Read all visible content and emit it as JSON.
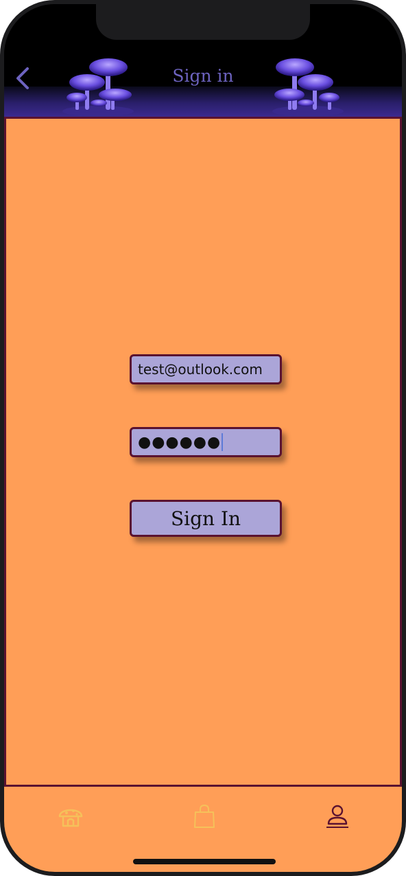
{
  "nav": {
    "title": "Sign in",
    "back_icon": "chevron-left-icon",
    "title_color": "#6d63c0"
  },
  "form": {
    "email_value": "test@outlook.com",
    "password_value": "●●●●●●",
    "sign_in_label": "Sign In"
  },
  "tabbar": {
    "items": [
      {
        "icon": "mushroom-house-icon",
        "color": "#f5c15a",
        "selected": false
      },
      {
        "icon": "shopping-bag-icon",
        "color": "#f5c15a",
        "selected": false
      },
      {
        "icon": "person-icon",
        "color": "#5a1230",
        "selected": true
      }
    ]
  },
  "colors": {
    "background": "#ff9e57",
    "field_fill": "#aba5d8",
    "border": "#5a1230",
    "header": "#000000"
  }
}
